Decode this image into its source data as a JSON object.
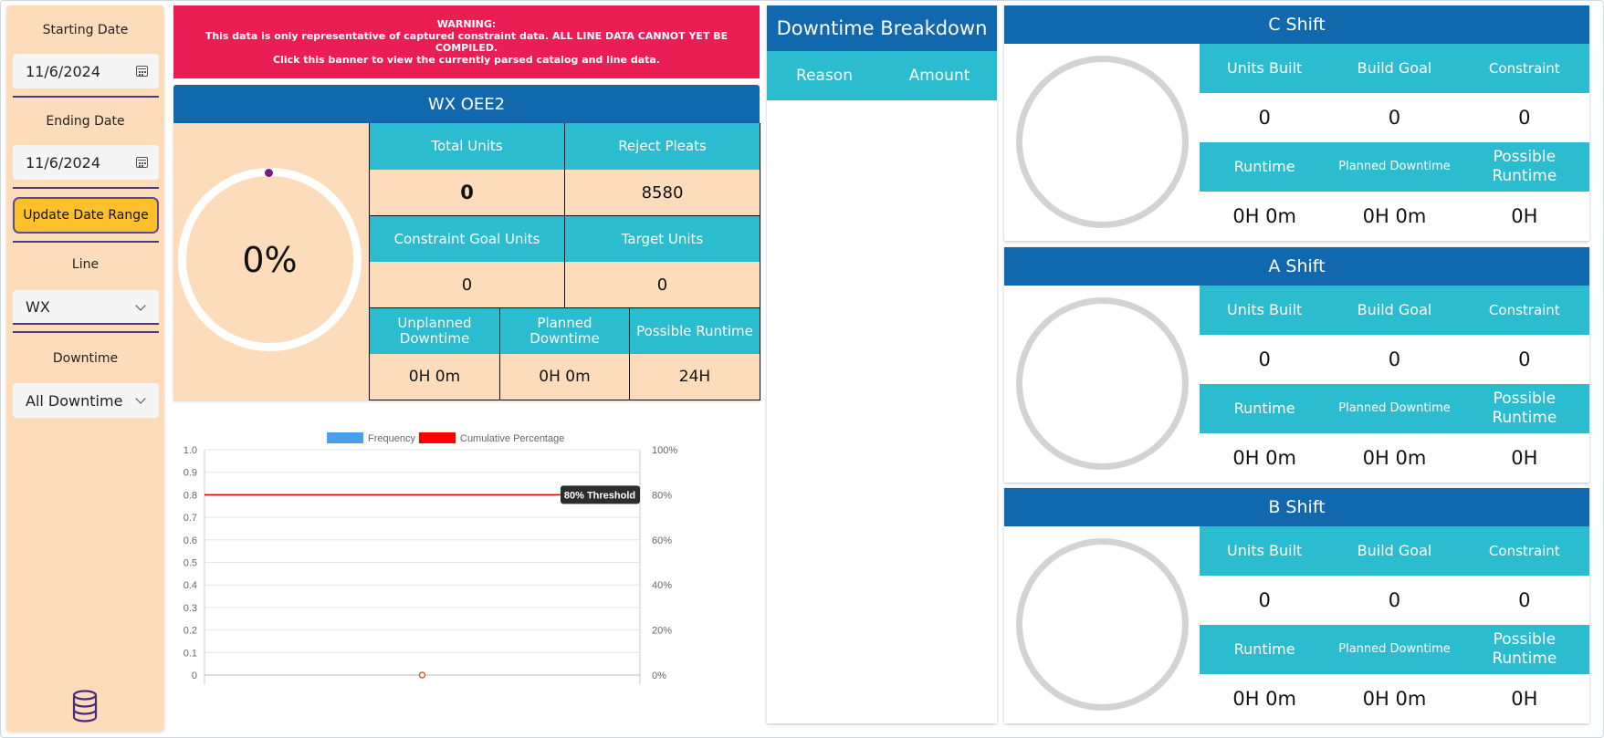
{
  "sidebar": {
    "starting_date_label": "Starting Date",
    "starting_date_value": "11/6/2024",
    "ending_date_label": "Ending Date",
    "ending_date_value": "11/6/2024",
    "update_button": "Update Date Range",
    "line_label": "Line",
    "line_value": "WX",
    "downtime_label": "Downtime",
    "downtime_value": "All Downtime",
    "icons": {
      "calendar": "calendar-icon",
      "chevron": "chevron-down-icon",
      "database": "database-icon"
    }
  },
  "warning": {
    "line1": "WARNING:",
    "line2": "This data is only representative of captured constraint data. ALL LINE DATA CANNOT YET BE COMPILED.",
    "line3": "Click this banner to view the currently parsed catalog and line data."
  },
  "oee": {
    "title": "WX OEE2",
    "percent": "0%",
    "total_units_label": "Total Units",
    "total_units_value": "0",
    "reject_pleats_label": "Reject Pleats",
    "reject_pleats_value": "8580",
    "constraint_goal_label": "Constraint Goal Units",
    "constraint_goal_value": "0",
    "target_units_label": "Target Units",
    "target_units_value": "0",
    "unplanned_downtime_label_1": "Unplanned",
    "unplanned_downtime_label_2": "Downtime",
    "unplanned_downtime_value": "0H 0m",
    "planned_downtime_label_1": "Planned",
    "planned_downtime_label_2": "Downtime",
    "planned_downtime_value": "0H 0m",
    "possible_runtime_label": "Possible Runtime",
    "possible_runtime_value": "24H"
  },
  "chart_data": {
    "type": "bar",
    "legend": [
      "Frequency",
      "Cumulative Percentage"
    ],
    "legend_placement": "top",
    "categories": [
      ""
    ],
    "series": [
      {
        "name": "Frequency",
        "values": [
          0
        ],
        "color": "#4a9eee"
      },
      {
        "name": "Cumulative Percentage",
        "values": [
          0
        ],
        "color": "#ff0000"
      }
    ],
    "ylim": [
      0,
      1.0
    ],
    "y_ticks": [
      "0",
      "0.1",
      "0.2",
      "0.3",
      "0.4",
      "0.5",
      "0.6",
      "0.7",
      "0.8",
      "0.9",
      "1.0"
    ],
    "y2lim": [
      0,
      100
    ],
    "y2_ticks": [
      "0%",
      "20%",
      "40%",
      "60%",
      "80%",
      "100%"
    ],
    "threshold": {
      "label": "80% Threshold",
      "value": 0.8,
      "color": "#e00000"
    },
    "grid": true
  },
  "downtime": {
    "title": "Downtime Breakdown",
    "col_reason": "Reason",
    "col_amount": "Amount"
  },
  "shifts": [
    {
      "title": "C Shift",
      "units_built_label": "Units Built",
      "build_goal_label": "Build Goal",
      "constraint_label": "Constraint",
      "units_built": "0",
      "build_goal": "0",
      "constraint": "0",
      "runtime_label": "Runtime",
      "planned_downtime_label": "Planned Downtime",
      "possible_runtime_label_1": "Possible",
      "possible_runtime_label_2": "Runtime",
      "runtime": "0H 0m",
      "planned_downtime": "0H 0m",
      "possible_runtime": "0H"
    },
    {
      "title": "A Shift",
      "units_built_label": "Units Built",
      "build_goal_label": "Build Goal",
      "constraint_label": "Constraint",
      "units_built": "0",
      "build_goal": "0",
      "constraint": "0",
      "runtime_label": "Runtime",
      "planned_downtime_label": "Planned Downtime",
      "possible_runtime_label_1": "Possible",
      "possible_runtime_label_2": "Runtime",
      "runtime": "0H 0m",
      "planned_downtime": "0H 0m",
      "possible_runtime": "0H"
    },
    {
      "title": "B Shift",
      "units_built_label": "Units Built",
      "build_goal_label": "Build Goal",
      "constraint_label": "Constraint",
      "units_built": "0",
      "build_goal": "0",
      "constraint": "0",
      "runtime_label": "Runtime",
      "planned_downtime_label": "Planned Downtime",
      "possible_runtime_label_1": "Possible",
      "possible_runtime_label_2": "Runtime",
      "runtime": "0H 0m",
      "planned_downtime": "0H 0m",
      "possible_runtime": "0H"
    }
  ]
}
